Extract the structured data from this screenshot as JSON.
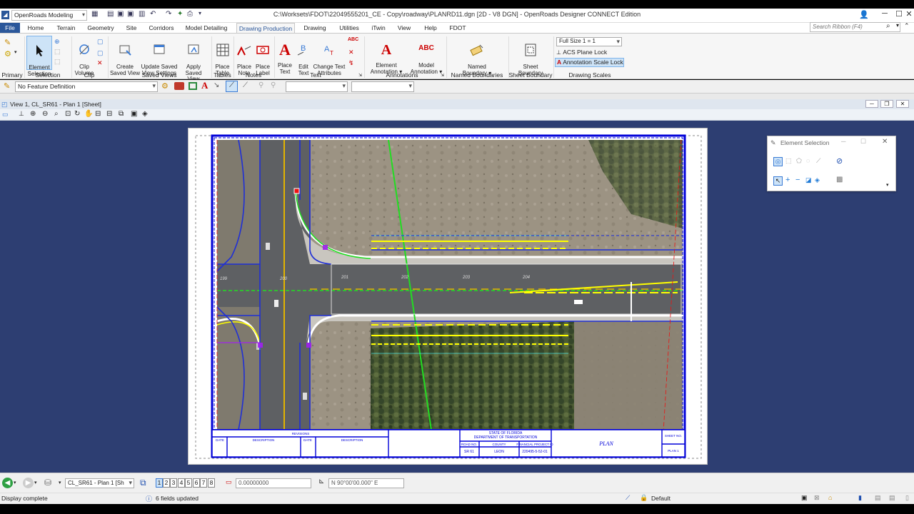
{
  "workflow": "OpenRoads Modeling",
  "title": "C:\\Worksets\\FDOT\\22049555201_CE - Copy\\roadway\\PLANRD11.dgn [2D - V8 DGN] - OpenRoads Designer CONNECT Edition",
  "menus": [
    "File",
    "Home",
    "Terrain",
    "Geometry",
    "Site",
    "Corridors",
    "Model Detailing",
    "Drawing Production",
    "Drawing",
    "Utilities",
    "iTwin",
    "View",
    "Help",
    "FDOT"
  ],
  "search_placeholder": "Search Ribbon (F4)",
  "ribbon": {
    "buttons": {
      "element_selection": "Element\nSelection",
      "clip_volume": "Clip\nVolume",
      "create_saved_view": "Create\nSaved View",
      "update_saved_view": "Update Saved\nView Settings",
      "apply_saved_view": "Apply\nSaved View",
      "place_table": "Place\nTable",
      "place_note": "Place\nNote",
      "place_label": "Place\nLabel",
      "place_text": "Place\nText",
      "edit_text": "Edit\nText",
      "change_text_attributes": "Change Text\nAttributes",
      "element_annotation": "Element\nAnnotation ▾",
      "model_annotation": "Model\nAnnotation ▾",
      "named_boundary": "Named\nBoundary ▾",
      "sheet_boundary": "Sheet\nBoundary"
    },
    "groups": [
      "Primary",
      "Selection",
      "Clip",
      "Saved Views",
      "Tables",
      "Notes",
      "Text",
      "Annotations",
      "Named Boundaries",
      "Sheet Boundary",
      "Drawing Scales"
    ],
    "scale_value": "Full Size 1 = 1",
    "acs_plane_lock": "ACS Plane Lock",
    "annotation_scale_lock": "Annotation Scale Lock"
  },
  "feature_definition": "No Feature Definition",
  "view_title": "View 1, CL_SR61 - Plan 1 [Sheet]",
  "element_selection_dialog": {
    "title": "Element Selection"
  },
  "sheet": {
    "stations": [
      "199",
      "200",
      "201",
      "202",
      "203",
      "204"
    ],
    "title_block": {
      "revisions": "REVISIONS",
      "date": "DATE",
      "description": "DESCRIPTION",
      "state": "STATE OF FLORIDA",
      "dept": "DEPARTMENT OF TRANSPORTATION",
      "road_no": "ROAD NO.",
      "county": "COUNTY",
      "fin_proj": "FINANCIAL PROJECT ID",
      "road_val": "SR 61",
      "county_val": "LEON",
      "proj_val": "220495-5-52-01",
      "plan": "PLAN",
      "sheet_no": "SHEET\nNO.",
      "sheet_val": "PLAN 1"
    }
  },
  "status": {
    "model": "CL_SR61 - Plan 1 [Sh",
    "views": [
      "1",
      "2",
      "3",
      "4",
      "5",
      "6",
      "7",
      "8"
    ],
    "active_view": "1",
    "coordinate": "0.00000000",
    "direction": "N 90°00'00.000\" E",
    "message": "Display complete",
    "fields": "6 fields updated",
    "level": "Default"
  },
  "colors": {
    "file_tab": "#2b579a",
    "view_bg": "#2d3e72",
    "sheet_border": "#0000d8",
    "highlight": "#ffff00",
    "route": "#22dd22"
  }
}
